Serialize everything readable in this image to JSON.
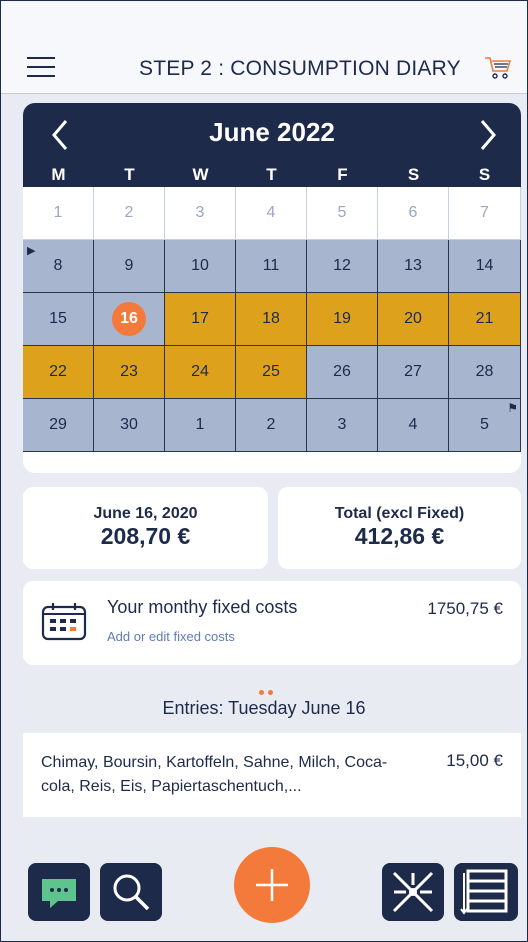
{
  "header": {
    "title": "STEP 2 : CONSUMPTION DIARY",
    "menu_icon": "hamburger-icon",
    "cart_icon": "cart-icon"
  },
  "calendar": {
    "month": "June 2022",
    "weekdays": [
      "M",
      "T",
      "W",
      "T",
      "F",
      "S",
      "S"
    ],
    "weeks": [
      [
        {
          "d": "1",
          "s": "faded"
        },
        {
          "d": "2",
          "s": "faded"
        },
        {
          "d": "3",
          "s": "faded"
        },
        {
          "d": "4",
          "s": "faded"
        },
        {
          "d": "5",
          "s": "faded"
        },
        {
          "d": "6",
          "s": "faded"
        },
        {
          "d": "7",
          "s": "faded"
        }
      ],
      [
        {
          "d": "8",
          "s": "gray",
          "flag": true
        },
        {
          "d": "9",
          "s": "gray"
        },
        {
          "d": "10",
          "s": "gray"
        },
        {
          "d": "11",
          "s": "gray"
        },
        {
          "d": "12",
          "s": "gray"
        },
        {
          "d": "13",
          "s": "gray"
        },
        {
          "d": "14",
          "s": "gray"
        }
      ],
      [
        {
          "d": "15",
          "s": "gray"
        },
        {
          "d": "16",
          "s": "gray",
          "today": true
        },
        {
          "d": "17",
          "s": "gold"
        },
        {
          "d": "18",
          "s": "gold"
        },
        {
          "d": "19",
          "s": "gold"
        },
        {
          "d": "20",
          "s": "gold"
        },
        {
          "d": "21",
          "s": "gold"
        }
      ],
      [
        {
          "d": "22",
          "s": "gold"
        },
        {
          "d": "23",
          "s": "gold"
        },
        {
          "d": "24",
          "s": "gold"
        },
        {
          "d": "25",
          "s": "gold"
        },
        {
          "d": "26",
          "s": "gray"
        },
        {
          "d": "27",
          "s": "gray"
        },
        {
          "d": "28",
          "s": "gray"
        }
      ],
      [
        {
          "d": "29",
          "s": "gray"
        },
        {
          "d": "30",
          "s": "gray"
        },
        {
          "d": "1",
          "s": "gray"
        },
        {
          "d": "2",
          "s": "gray"
        },
        {
          "d": "3",
          "s": "gray"
        },
        {
          "d": "4",
          "s": "gray"
        },
        {
          "d": "5",
          "s": "gray",
          "finish": true
        }
      ]
    ]
  },
  "summary": {
    "day_label": "June 16, 2020",
    "day_value": "208,70 €",
    "total_label": "Total (excl Fixed)",
    "total_value": "412,86 €"
  },
  "fixed": {
    "title": "Your monthy fixed costs",
    "link": "Add or edit fixed costs",
    "amount": "1750,75 €"
  },
  "entries": {
    "title": "Entries: Tuesday June 16",
    "items": [
      {
        "text": "Chimay, Boursin, Kartoffeln, Sahne, Milch, Coca-cola, Reis, Eis, Papiertaschentuch,...",
        "amount": "15,00 €"
      }
    ]
  },
  "toolbar": {
    "icons": [
      "chat-icon",
      "search-icon",
      "add-icon",
      "scatter-icon",
      "list-icon"
    ]
  },
  "colors": {
    "navy": "#1d2a4a",
    "gold": "#dea11c",
    "gray": "#a8b5cf",
    "orange": "#f47a3b"
  }
}
